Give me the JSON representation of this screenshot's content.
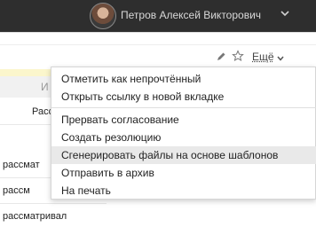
{
  "topbar": {
    "user_name": "Петров Алексей Викторович"
  },
  "toolbar": {
    "more_label": "Ещё"
  },
  "table": {
    "header_fragment": "И",
    "rows": [
      "Расс",
      "рассмат",
      "рассм",
      "рассматривал"
    ]
  },
  "menu": {
    "items": [
      "Отметить как непрочтённый",
      "Открыть ссылку в новой вкладке",
      "Прервать согласование",
      "Создать резолюцию",
      "Сгенерировать файлы на основе шаблонов",
      "Отправить в архив",
      "На печать"
    ]
  },
  "colors": {
    "topbar_bg": "#2e2e2e",
    "menu_hover_bg": "#e9e9e9",
    "highlight_strip": "#fbf6cc"
  },
  "icons": [
    "user-avatar",
    "chevron-down-icon",
    "pencil-icon",
    "star-icon"
  ]
}
